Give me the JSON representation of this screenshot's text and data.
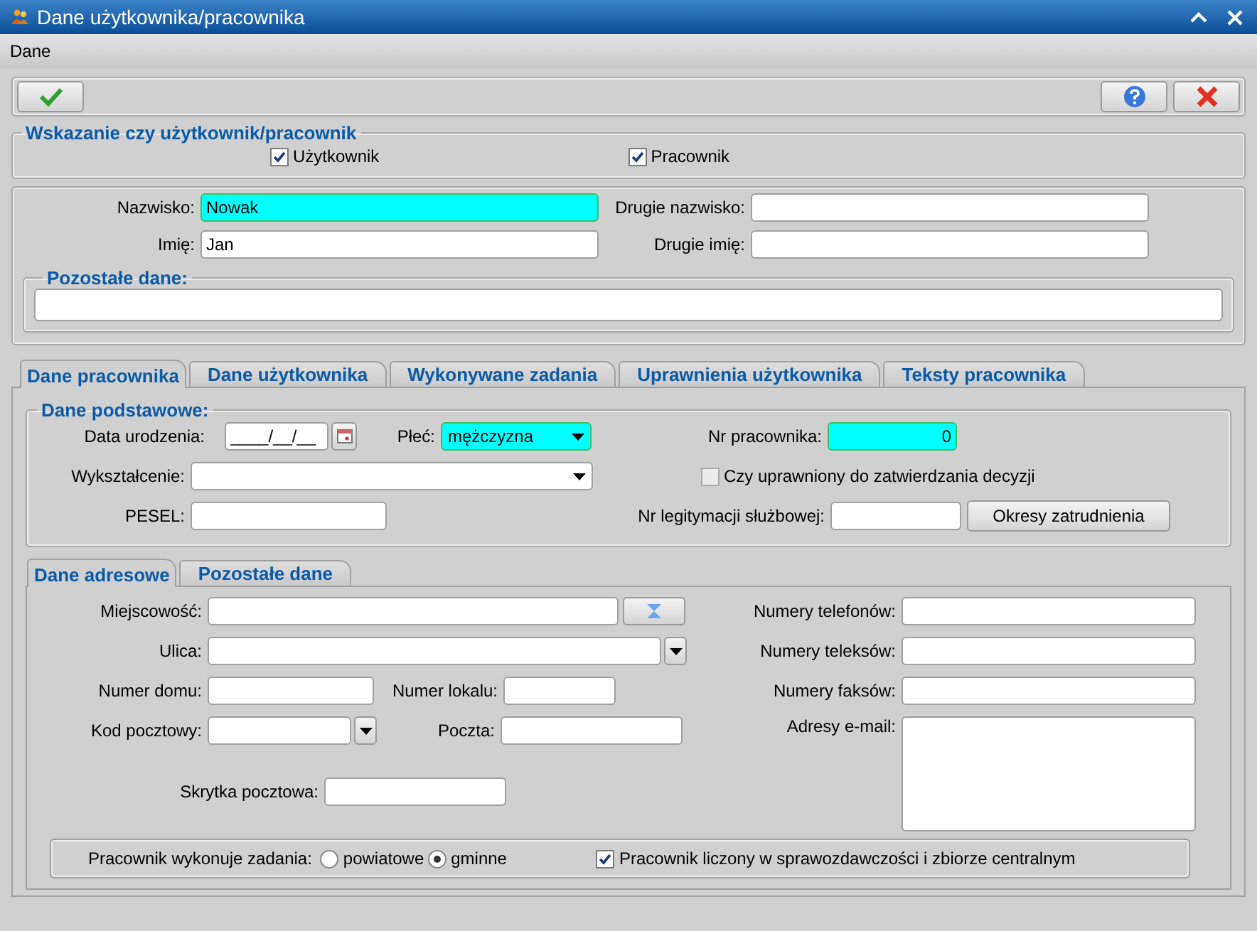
{
  "window": {
    "title": "Dane użytkownika/pracownika"
  },
  "menu": [
    {
      "label": "Dane"
    }
  ],
  "user_kind": {
    "title": "Wskazanie czy użytkownik/pracownik",
    "options": [
      {
        "label": "Użytkownik",
        "checked": true
      },
      {
        "label": "Pracownik",
        "checked": true
      }
    ]
  },
  "person": {
    "fields": [
      {
        "label": "Nazwisko:",
        "value": "Nowak",
        "highlighted": true
      },
      {
        "label": "Drugie nazwisko:",
        "highlighted": false
      },
      {
        "label": "Imię:",
        "value": "Jan",
        "highlighted": false
      },
      {
        "label": "Drugie imię:",
        "highlighted": false
      }
    ],
    "other_title": "Pozostałe dane:"
  },
  "tabs": [
    {
      "label": "Dane pracownika",
      "selected": true
    },
    {
      "label": "Dane użytkownika",
      "selected": false
    },
    {
      "label": "Wykonywane zadania",
      "selected": false
    },
    {
      "label": "Uprawnienia użytkownika",
      "selected": false
    },
    {
      "label": "Teksty pracownika",
      "selected": false
    }
  ],
  "basic": {
    "title": "Dane podstawowe:",
    "birth_date": {
      "label": "Data urodzenia:",
      "placeholder": "____/__/__"
    },
    "gender": {
      "label": "Płeć:",
      "value": "mężczyzna",
      "highlighted": true
    },
    "employee_no": {
      "label": "Nr pracownika:",
      "value": "0",
      "highlighted": true
    },
    "education": {
      "label": "Wykształcenie:"
    },
    "authorized": {
      "label": "Czy uprawniony do zatwierdzania decyzji",
      "checked": false
    },
    "pesel": {
      "label": "PESEL:"
    },
    "id_card": {
      "label": "Nr legitymacji służbowej:"
    },
    "periods_button": "Okresy zatrudnienia"
  },
  "address_tabs": [
    {
      "label": "Dane adresowe",
      "selected": true
    },
    {
      "label": "Pozostałe dane",
      "selected": false
    }
  ],
  "address": {
    "city": "Miejscowość:",
    "street": "Ulica:",
    "house_no": "Numer domu:",
    "flat_no": "Numer lokalu:",
    "postal_code": "Kod pocztowy:",
    "post_office": "Poczta:",
    "po_box": "Skrytka pocztowa:",
    "phones": "Numery telefonów:",
    "telexes": "Numery teleksów:",
    "faxes": "Numery faksów:",
    "emails": "Adresy e-mail:"
  },
  "tasks": {
    "label": "Pracownik wykonuje zadania:",
    "options": [
      {
        "label": "powiatowe",
        "selected": false
      },
      {
        "label": "gminne",
        "selected": true
      }
    ],
    "counted": {
      "label": "Pracownik liczony w sprawozdawczości i zbiorze centralnym",
      "checked": true
    }
  }
}
